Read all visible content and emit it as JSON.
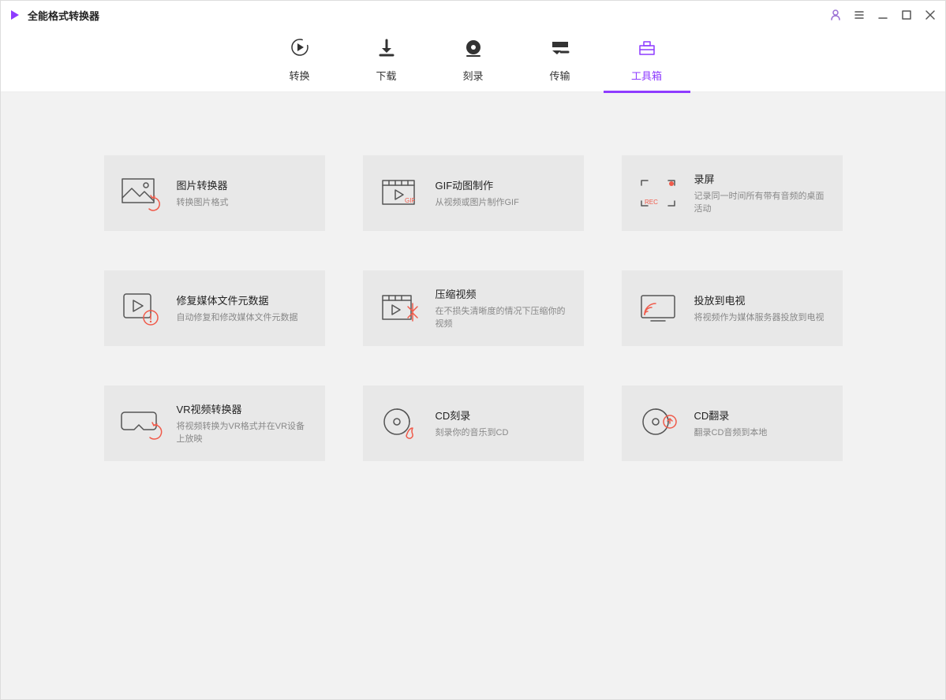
{
  "app": {
    "title": "全能格式转换器"
  },
  "tabs": {
    "convert": "转换",
    "download": "下载",
    "burn": "刻录",
    "transfer": "传输",
    "toolbox": "工具箱"
  },
  "tools": {
    "image_convert": {
      "title": "图片转换器",
      "desc": "转换图片格式"
    },
    "gif_maker": {
      "title": "GIF动图制作",
      "desc": "从视频或图片制作GIF"
    },
    "screen_record": {
      "title": "录屏",
      "desc": "记录同一时间所有带有音频的桌面活动"
    },
    "fix_metadata": {
      "title": "修复媒体文件元数据",
      "desc": "自动修复和修改媒体文件元数据"
    },
    "compress_video": {
      "title": "压缩视频",
      "desc": "在不损失清晰度的情况下压缩你的视频"
    },
    "cast_tv": {
      "title": "投放到电视",
      "desc": "将视频作为媒体服务器投放到电视"
    },
    "vr_convert": {
      "title": "VR视频转换器",
      "desc": "将视频转换为VR格式并在VR设备上放映"
    },
    "cd_burn": {
      "title": "CD刻录",
      "desc": "刻录你的音乐到CD"
    },
    "cd_rip": {
      "title": "CD翻录",
      "desc": "翻录CD音频到本地"
    }
  }
}
